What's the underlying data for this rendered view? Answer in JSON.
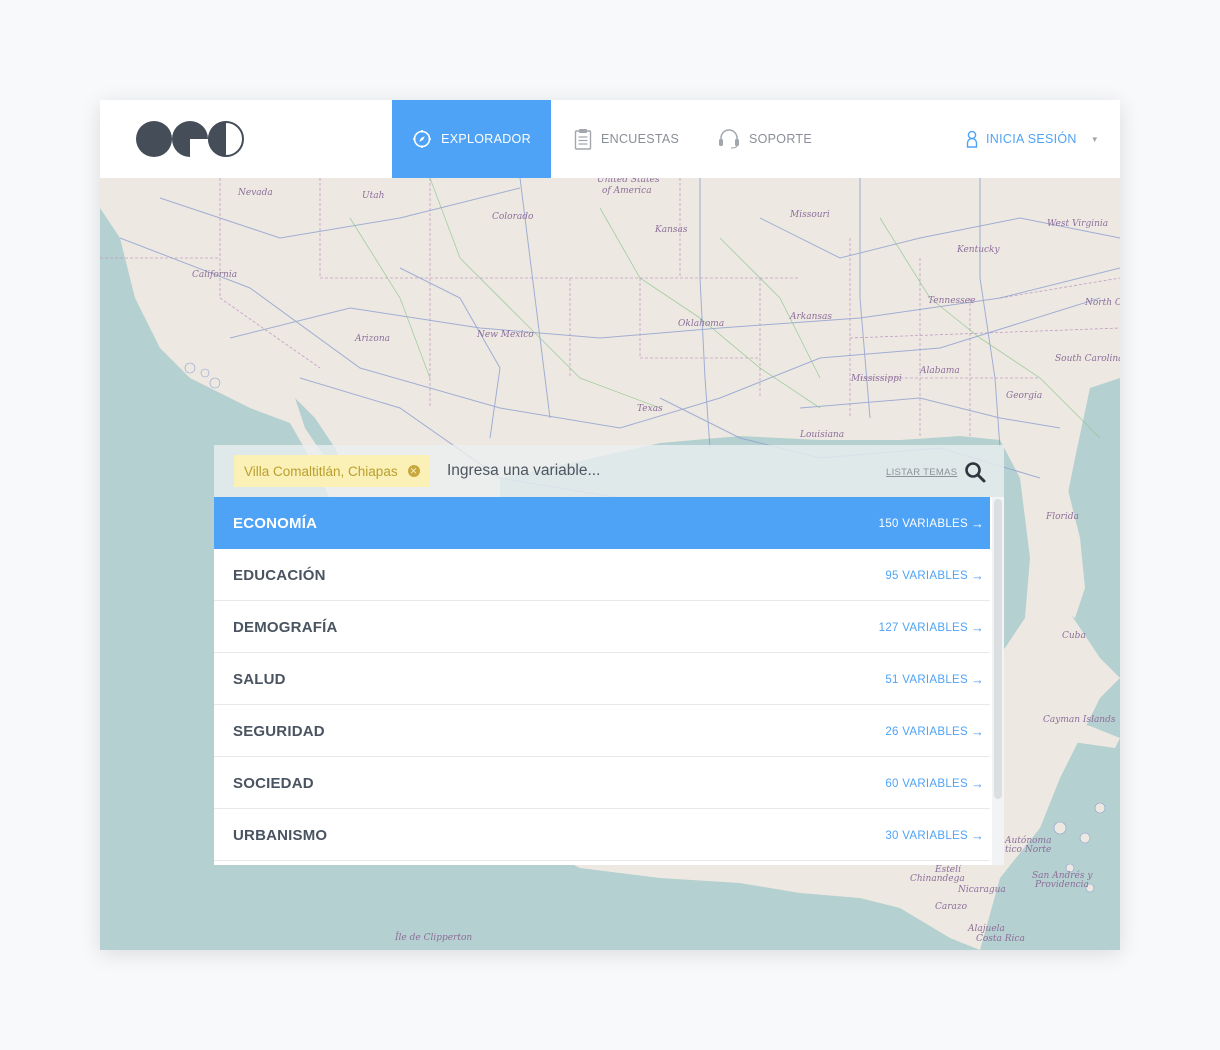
{
  "nav": {
    "items": [
      {
        "label": "EXPLORADOR",
        "icon": "compass-icon",
        "active": true
      },
      {
        "label": "ENCUESTAS",
        "icon": "clipboard-icon",
        "active": false
      },
      {
        "label": "SOPORTE",
        "icon": "headset-icon",
        "active": false
      }
    ],
    "login_label": "INICIA SESIÓN"
  },
  "map": {
    "labels": [
      "Nevada",
      "Utah",
      "United States",
      "of America",
      "Colorado",
      "Kansas",
      "Missouri",
      "West Virginia",
      "Kentucky",
      "California",
      "Tennessee",
      "North Ca",
      "Arizona",
      "New Mexico",
      "Oklahoma",
      "Arkansas",
      "South Carolina",
      "Mississippi",
      "Alabama",
      "Georgia",
      "Texas",
      "Louisiana",
      "Florida",
      "Cuba",
      "Cayman Islands",
      "Autónoma",
      "tico Norte",
      "San Andrés y",
      "Providencia",
      "Estelí",
      "Chinandega",
      "Nicaragua",
      "Carazo",
      "Alajuela",
      "Costa Rica",
      "Île de Clipperton"
    ]
  },
  "search": {
    "location_tag": "Villa Comaltitlán, Chiapas",
    "placeholder": "Ingresa una variable...",
    "list_topics_label": "LISTAR TEMAS"
  },
  "topics": [
    {
      "name": "ECONOMÍA",
      "count": "150 VARIABLES",
      "active": true
    },
    {
      "name": "EDUCACIÓN",
      "count": "95 VARIABLES",
      "active": false
    },
    {
      "name": "DEMOGRAFÍA",
      "count": "127 VARIABLES",
      "active": false
    },
    {
      "name": "SALUD",
      "count": "51 VARIABLES",
      "active": false
    },
    {
      "name": "SEGURIDAD",
      "count": "26 VARIABLES",
      "active": false
    },
    {
      "name": "SOCIEDAD",
      "count": "60 VARIABLES",
      "active": false
    },
    {
      "name": "URBANISMO",
      "count": "30 VARIABLES",
      "active": false
    }
  ],
  "colors": {
    "accent": "#4fa3f7",
    "location_tag_bg": "#fbf0b5",
    "map_land": "#ede9e2",
    "map_water": "#b5d0d0"
  }
}
